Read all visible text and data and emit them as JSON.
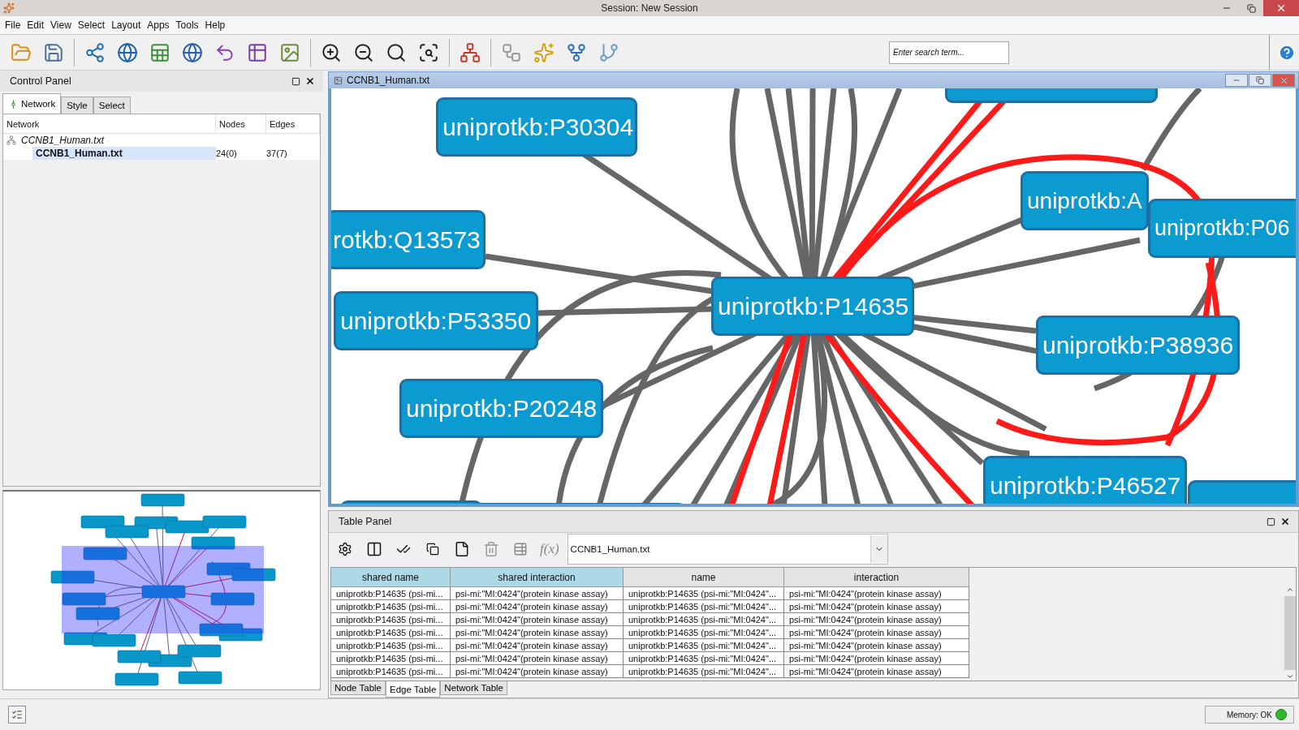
{
  "window": {
    "title": "Session: New Session"
  },
  "menu": [
    "File",
    "Edit",
    "View",
    "Select",
    "Layout",
    "Apps",
    "Tools",
    "Help"
  ],
  "search": {
    "placeholder": "Enter search term..."
  },
  "control_panel": {
    "title": "Control Panel",
    "tabs": [
      {
        "label": "Network",
        "selected": true
      },
      {
        "label": "Style",
        "selected": false
      },
      {
        "label": "Select",
        "selected": false
      }
    ],
    "columns": [
      "Network",
      "Nodes",
      "Edges"
    ],
    "collection": {
      "name": "CCNB1_Human.txt",
      "children": [
        {
          "name": "CCNB1_Human.txt",
          "nodes": "24(0)",
          "edges": "37(7)",
          "selected": true
        }
      ]
    }
  },
  "overview": {
    "kind": "picture"
  },
  "network_view": {
    "title": "CCNB1_Human.txt",
    "nodes": [
      {
        "label": "uniprotkb:P30304"
      },
      {
        "label": "rotkb:Q13573"
      },
      {
        "label": "uniprotkb:P53350"
      },
      {
        "label": "uniprotkb:P20248"
      },
      {
        "label": "uniprotkb:P14635"
      },
      {
        "label": "uniprotkb:A"
      },
      {
        "label": "uniprotkb:P06"
      },
      {
        "label": "uniprotkb:P38936"
      },
      {
        "label": "uniprotkb:P46527"
      }
    ]
  },
  "table_panel": {
    "title": "Table Panel",
    "function_button": "f(x)",
    "table_select": "CCNB1_Human.txt",
    "columns": [
      {
        "label": "shared name",
        "selected": true
      },
      {
        "label": "shared interaction",
        "selected": true
      },
      {
        "label": "name",
        "selected": false
      },
      {
        "label": "interaction",
        "selected": false
      }
    ],
    "rows": [
      [
        "uniprotkb:P14635 (psi-mi...",
        "psi-mi:\"MI:0424\"(protein kinase assay)",
        "uniprotkb:P14635 (psi-mi:\"MI:0424\"...",
        "psi-mi:\"MI:0424\"(protein kinase assay)"
      ],
      [
        "uniprotkb:P14635 (psi-mi...",
        "psi-mi:\"MI:0424\"(protein kinase assay)",
        "uniprotkb:P14635 (psi-mi:\"MI:0424\"...",
        "psi-mi:\"MI:0424\"(protein kinase assay)"
      ],
      [
        "uniprotkb:P14635 (psi-mi...",
        "psi-mi:\"MI:0424\"(protein kinase assay)",
        "uniprotkb:P14635 (psi-mi:\"MI:0424\"...",
        "psi-mi:\"MI:0424\"(protein kinase assay)"
      ],
      [
        "uniprotkb:P14635 (psi-mi...",
        "psi-mi:\"MI:0424\"(protein kinase assay)",
        "uniprotkb:P14635 (psi-mi:\"MI:0424\"...",
        "psi-mi:\"MI:0424\"(protein kinase assay)"
      ],
      [
        "uniprotkb:P14635 (psi-mi...",
        "psi-mi:\"MI:0424\"(protein kinase assay)",
        "uniprotkb:P14635 (psi-mi:\"MI:0424\"...",
        "psi-mi:\"MI:0424\"(protein kinase assay)"
      ],
      [
        "uniprotkb:P14635 (psi-mi...",
        "psi-mi:\"MI:0424\"(protein kinase assay)",
        "uniprotkb:P14635 (psi-mi:\"MI:0424\"...",
        "psi-mi:\"MI:0424\"(protein kinase assay)"
      ],
      [
        "uniprotkb:P14635 (psi-mi...",
        "psi-mi:\"MI:0424\"(protein kinase assay)",
        "uniprotkb:P14635 (psi-mi:\"MI:0424\"...",
        "psi-mi:\"MI:0424\"(protein kinase assay)"
      ]
    ],
    "tabs": [
      {
        "label": "Node Table",
        "selected": false
      },
      {
        "label": "Edge Table",
        "selected": true
      },
      {
        "label": "Network Table",
        "selected": false
      }
    ]
  },
  "status_bar": {
    "memory": "Memory: OK"
  }
}
